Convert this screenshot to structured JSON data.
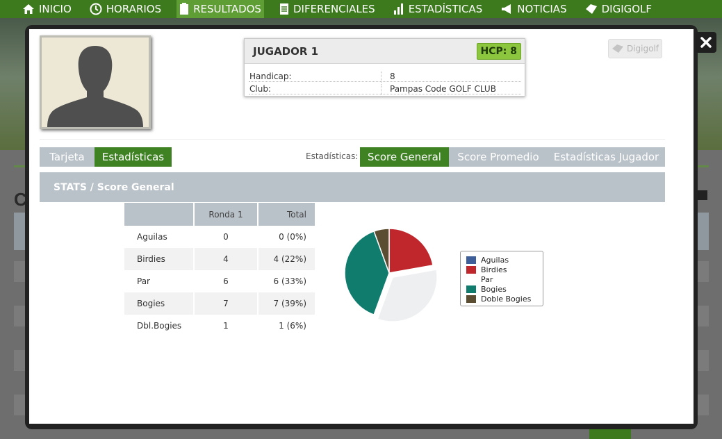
{
  "nav": {
    "items": [
      {
        "label": "INICIO",
        "icon": "home-icon"
      },
      {
        "label": "HORARIOS",
        "icon": "clock-icon"
      },
      {
        "label": "RESULTADOS",
        "icon": "clipboard-icon"
      },
      {
        "label": "DIFERENCIALES",
        "icon": "document-icon"
      },
      {
        "label": "ESTADÍSTICAS",
        "icon": "bar-chart-icon"
      },
      {
        "label": "NOTICIAS",
        "icon": "megaphone-icon"
      },
      {
        "label": "DIGIGOLF",
        "icon": "tag-icon"
      }
    ],
    "active": "RESULTADOS"
  },
  "background": {
    "letter": "C"
  },
  "player": {
    "name": "JUGADOR 1",
    "hcp_badge": "HCP: 8",
    "handicap_label": "Handicap:",
    "handicap_value": "8",
    "club_label": "Club:",
    "club_value": "Pampas Code GOLF CLUB"
  },
  "digigolf_button": "Digigolf",
  "tabs": {
    "tarjeta": "Tarjeta",
    "estadisticas": "Estadísticas",
    "stats_label": "Estadísticas:",
    "score_general": "Score General",
    "score_promedio": "Score Promedio",
    "estadisticas_jugador": "Estadísticas Jugador"
  },
  "section_title": "STATS / Score General",
  "table": {
    "headers": [
      "",
      "Ronda 1",
      "Total"
    ],
    "rows": [
      {
        "label": "Aguilas",
        "ronda": "0",
        "total": "0 (0%)"
      },
      {
        "label": "Birdies",
        "ronda": "4",
        "total": "4 (22%)"
      },
      {
        "label": "Par",
        "ronda": "6",
        "total": "6 (33%)"
      },
      {
        "label": "Bogies",
        "ronda": "7",
        "total": "7 (39%)"
      },
      {
        "label": "Dbl.Bogies",
        "ronda": "1",
        "total": "1 (6%)"
      }
    ]
  },
  "colors": {
    "aguilas": "#3f5f9a",
    "birdies": "#c0272d",
    "par": "#eeeff0",
    "bogies": "#107c6d",
    "doble_bogies": "#5b4d31",
    "accent_green": "#3e8224"
  },
  "chart_data": {
    "type": "pie",
    "legend_placement": "right",
    "categories": [
      "Aguilas",
      "Birdies",
      "Par",
      "Bogies",
      "Doble Bogies"
    ],
    "values": [
      0,
      4,
      6,
      7,
      1
    ],
    "exploded": "Par"
  }
}
